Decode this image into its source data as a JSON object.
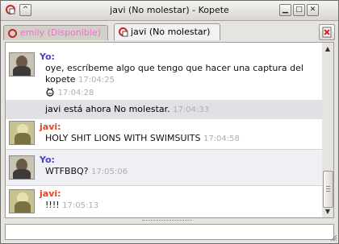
{
  "window": {
    "title": "javi (No molestar) - Kopete",
    "minimize_glyph": "▁",
    "maximize_glyph": "□",
    "close_glyph": "✕",
    "menu_glyph": "^"
  },
  "tabs": [
    {
      "label": "emily (Disponible)",
      "color": "#f070c8",
      "active": false
    },
    {
      "label": "javi (No molestar)",
      "color": "#000000",
      "active": true
    }
  ],
  "colors": {
    "self_name": "#4f3ec4",
    "contact_name": "#e0461f",
    "timestamp": "#aeaeae",
    "status_icon": "#cc2222"
  },
  "messages": [
    {
      "sender": "Yo:",
      "lines": [
        "oye, escríbeme algo que tengo que hacer una captura del",
        "kopete"
      ],
      "time": "17:04:25",
      "followup_emoticon": "ὑB",
      "followup_time": "17:04:28"
    },
    {
      "type": "status",
      "text": "javi está ahora No molestar.",
      "time": "17:04:33"
    },
    {
      "sender": "javi:",
      "text": "HOLY SHIT LIONS WITH SWIMSUITS",
      "time": "17:04:58"
    },
    {
      "sender": "Yo:",
      "text": "WTFBBQ?",
      "time": "17:05:06"
    },
    {
      "sender": "javi:",
      "text": "!!!!",
      "time": "17:05:13"
    }
  ],
  "scrollbar": {
    "up_glyph": "▲",
    "down_glyph": "▼"
  },
  "input": {
    "value": ""
  }
}
